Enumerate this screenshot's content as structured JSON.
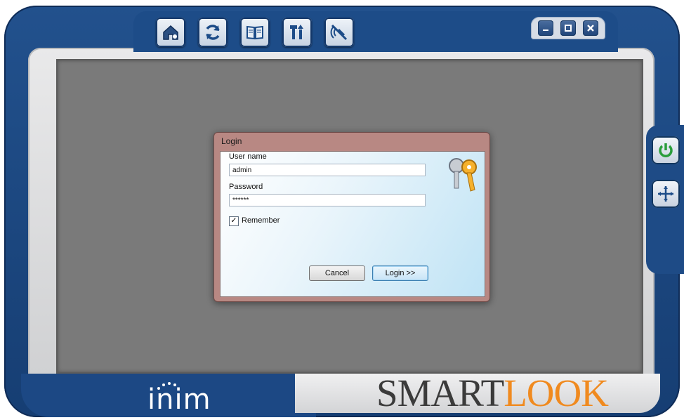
{
  "toolbar": {
    "icons": [
      "home-icon",
      "refresh-icon",
      "book-icon",
      "tools-icon",
      "mute-icon"
    ]
  },
  "window_controls": {
    "icons": [
      "minimize-icon",
      "restore-icon",
      "close-icon"
    ]
  },
  "side_panel": {
    "icons": [
      "power-icon",
      "move-icon"
    ],
    "accent": "#2a9d3b"
  },
  "login": {
    "title": "Login",
    "username_label": "User name",
    "username_value": "admin",
    "password_label": "Password",
    "password_value": "******",
    "remember_label": "Remember",
    "remember_checked": true,
    "cancel_label": "Cancel",
    "login_label": "Login >>"
  },
  "branding": {
    "inim": "inim",
    "smart": "SMART",
    "look": "LOOK",
    "orange": "#f08a1f"
  }
}
